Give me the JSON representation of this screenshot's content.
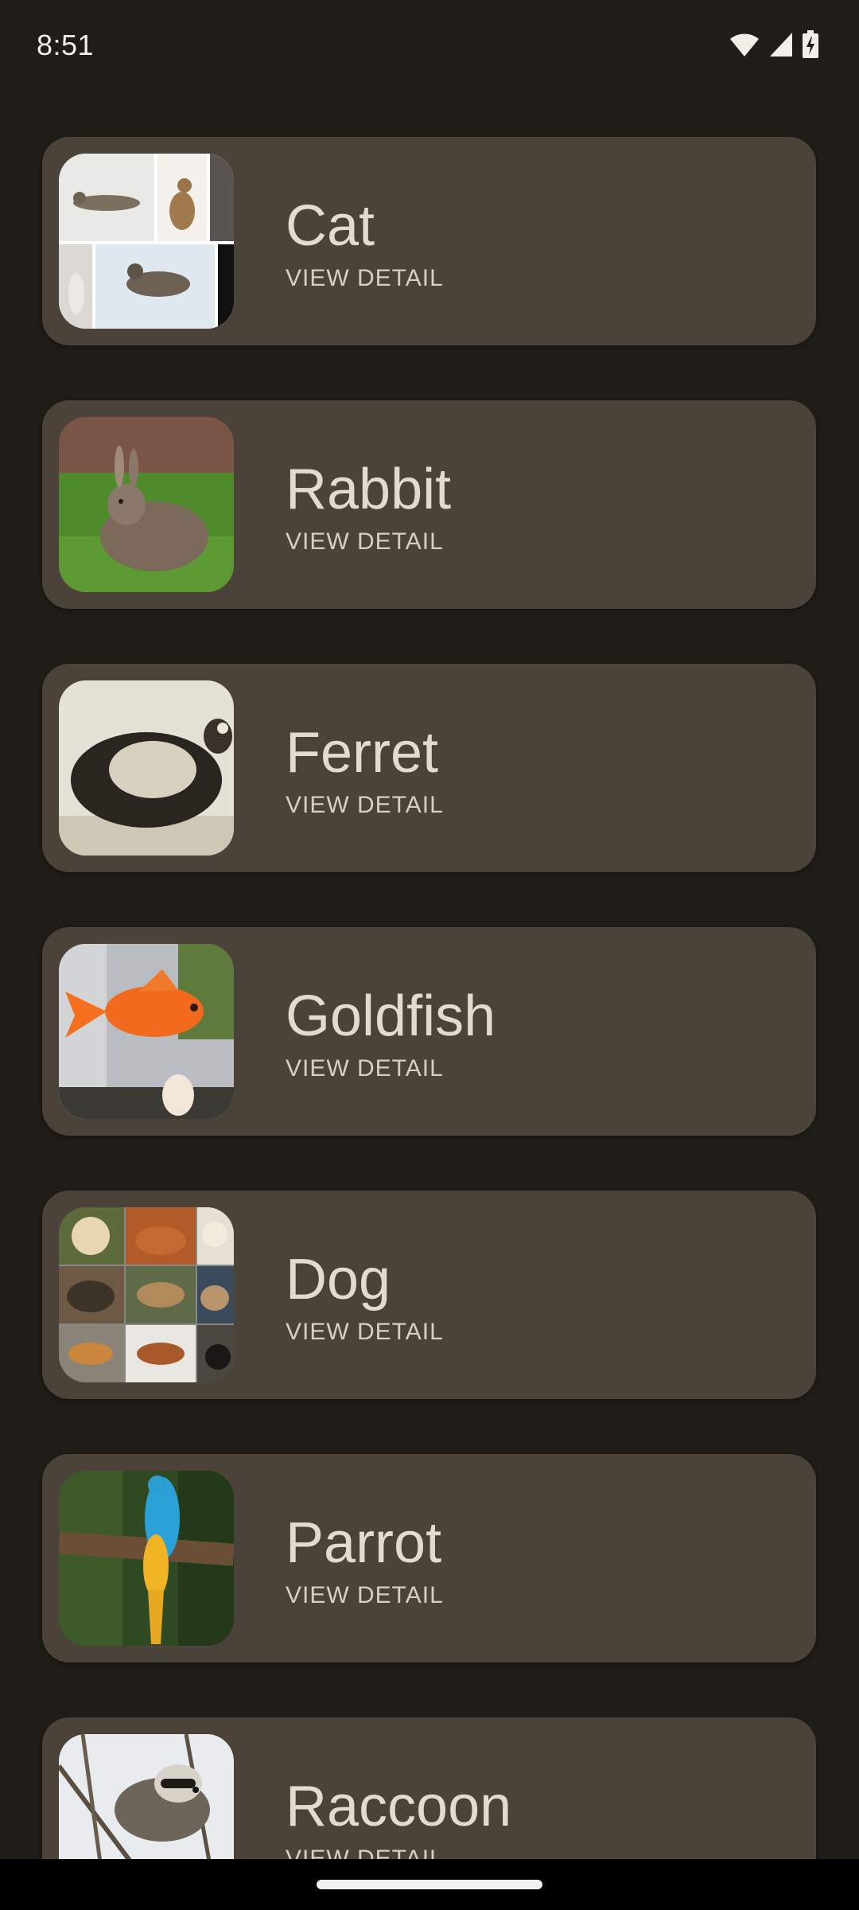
{
  "status_bar": {
    "time": "8:51",
    "icons": [
      "wifi-icon",
      "cellular-signal-icon",
      "battery-charging-icon"
    ]
  },
  "animals": [
    {
      "name": "Cat",
      "action": "VIEW DETAIL",
      "image": "cat-collage-photo"
    },
    {
      "name": "Rabbit",
      "action": "VIEW DETAIL",
      "image": "rabbit-on-grass-photo"
    },
    {
      "name": "Ferret",
      "action": "VIEW DETAIL",
      "image": "ferret-photo"
    },
    {
      "name": "Goldfish",
      "action": "VIEW DETAIL",
      "image": "goldfish-photo"
    },
    {
      "name": "Dog",
      "action": "VIEW DETAIL",
      "image": "dog-breeds-collage-photo"
    },
    {
      "name": "Parrot",
      "action": "VIEW DETAIL",
      "image": "macaw-parrot-photo"
    },
    {
      "name": "Raccoon",
      "action": "VIEW DETAIL",
      "image": "raccoon-in-tree-photo"
    }
  ],
  "colors": {
    "background": "#201c18",
    "card": "#4b433a",
    "title_text": "#e3dbd0",
    "action_text": "#d8cfc3"
  }
}
